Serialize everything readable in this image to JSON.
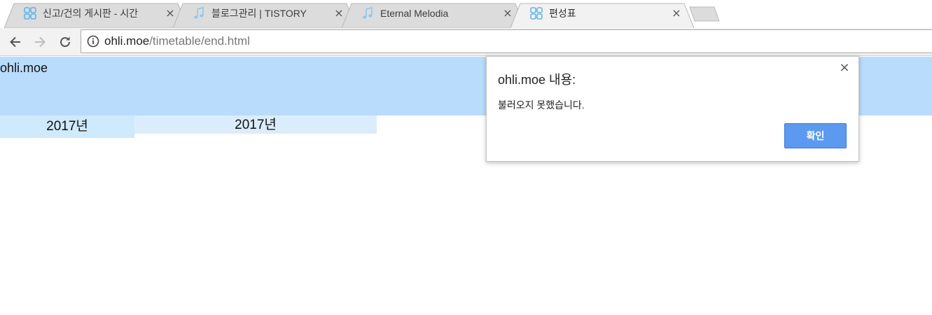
{
  "tabs": [
    {
      "title": "신고/건의 게시판 - 시간",
      "icon": "ohli-favicon",
      "active": false
    },
    {
      "title": "블로그관리 | TISTORY",
      "icon": "music-note-icon",
      "active": false
    },
    {
      "title": "Eternal Melodia",
      "icon": "music-note-icon",
      "active": false
    },
    {
      "title": "편성표",
      "icon": "ohli-favicon",
      "active": true
    }
  ],
  "tab_close_glyph": "×",
  "address_bar": {
    "host": "ohli.moe",
    "path": "/timetable/end.html"
  },
  "page": {
    "site_name": "ohli.moe",
    "year_cells": [
      "2017년",
      "2017년"
    ]
  },
  "dialog": {
    "title": "ohli.moe 내용:",
    "message": "불러오지 못했습니다.",
    "ok_label": "확인",
    "close_glyph": "×"
  },
  "colors": {
    "header_band": "#b9dcfd",
    "year_cell_1": "#cfe9fd",
    "year_cell_2": "#dbedfc",
    "dialog_button": "#5c99f0",
    "active_tab": "#f2f2f2",
    "inactive_tab": "#dcdcdc"
  }
}
